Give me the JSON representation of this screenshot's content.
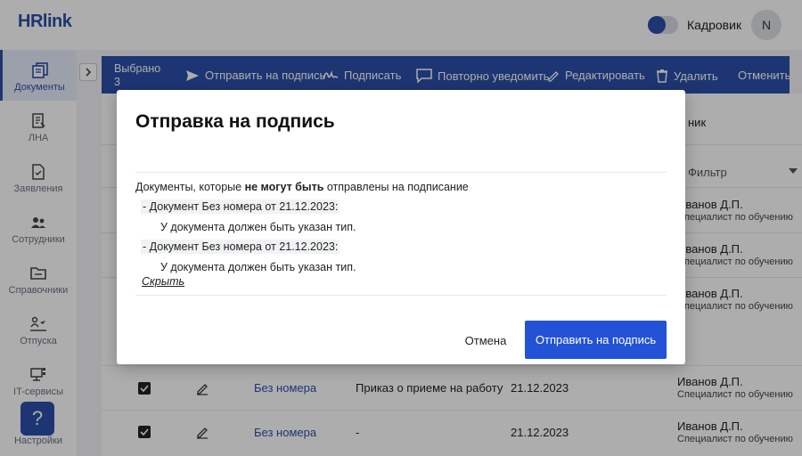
{
  "header": {
    "logo": "HRlink",
    "role_label": "Кадровик",
    "avatar_initial": "N"
  },
  "sidebar": {
    "items": [
      {
        "label": "Документы",
        "icon": "documents-icon"
      },
      {
        "label": "ЛНА",
        "icon": "lna-icon"
      },
      {
        "label": "Заявления",
        "icon": "applications-icon"
      },
      {
        "label": "Сотрудники",
        "icon": "employees-icon"
      },
      {
        "label": "Справочники",
        "icon": "folder-icon"
      },
      {
        "label": "Отпуска",
        "icon": "vacation-icon"
      },
      {
        "label": "IT-сервисы",
        "icon": "it-services-icon"
      },
      {
        "label": "Настройки",
        "icon": "settings-icon"
      }
    ],
    "help_label": "?"
  },
  "actionbar": {
    "selected_label": "Выбрано",
    "selected_count": "3",
    "send_label": "Отправить на подпись",
    "sign_label": "Подписать",
    "renotify_label": "Повторно уведомить",
    "edit_label": "Редактировать",
    "delete_label": "Удалить",
    "cancel_label": "Отменить"
  },
  "table": {
    "header_partial": "ник",
    "filter_label": "Фильтр",
    "rows": [
      {
        "name": "Иванов Д.П.",
        "position": "Специалист по обучению"
      },
      {
        "name": "Иванов Д.П.",
        "position": "Специалист по обучению"
      },
      {
        "name": "Иванов Д.П.",
        "position": "Специалист по обучению"
      },
      {
        "number": "Без номера",
        "type": "Приказ о приеме на работу",
        "date": "21.12.2023",
        "name": "Иванов Д.П.",
        "position": "Специалист по обучению"
      },
      {
        "number": "Без номера",
        "type": "-",
        "date": "21.12.2023",
        "name": "Иванов Д.П.",
        "position": "Специалист по обучению"
      }
    ]
  },
  "modal": {
    "title": "Отправка на подпись",
    "intro_before": "Документы, которые ",
    "intro_bold": "не могут быть",
    "intro_after": " отправлены на подписание",
    "errors": [
      {
        "doc": "- Документ Без номера от 21.12.2023:",
        "reason": "У документа должен быть указан тип."
      },
      {
        "doc": "- Документ Без номера от 21.12.2023:",
        "reason": "У документа должен быть указан тип."
      }
    ],
    "hide_label": "Скрыть",
    "cancel_label": "Отмена",
    "submit_label": "Отправить на подпись"
  },
  "colors": {
    "brand": "#2b4fa8",
    "primary_button": "#2252d6"
  }
}
